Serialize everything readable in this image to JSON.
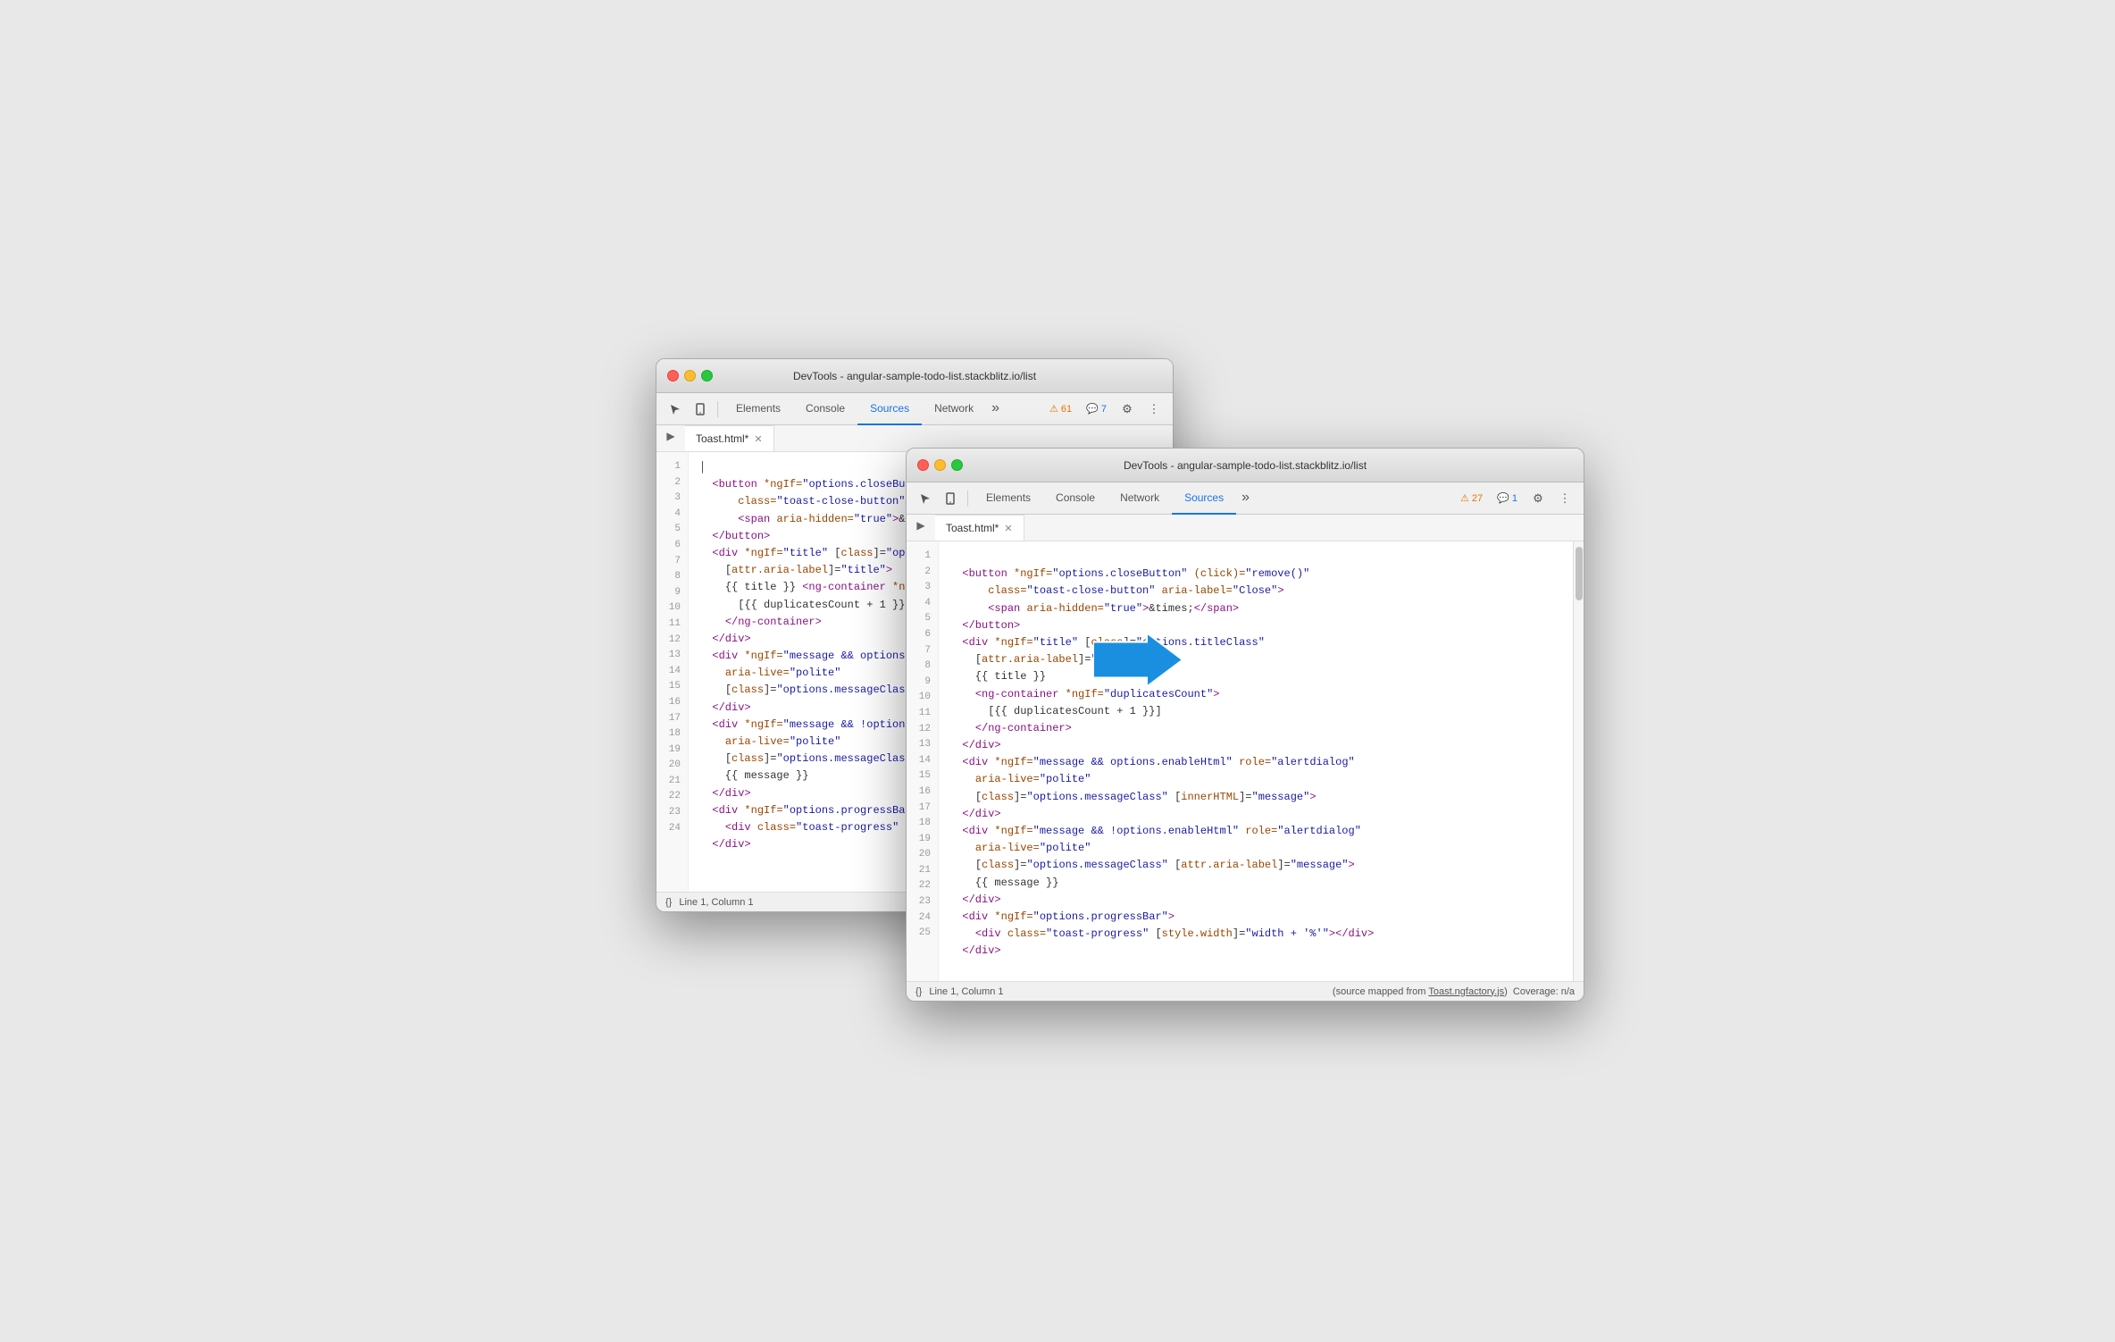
{
  "back_window": {
    "title": "DevTools - angular-sample-todo-list.stackblitz.io/list",
    "tabs": [
      "Elements",
      "Console",
      "Sources",
      "Network"
    ],
    "active_tab": "Sources",
    "file_tab": "Toast.html*",
    "badges": {
      "warning": "⚠ 61",
      "comment": "💬 7"
    },
    "statusbar": {
      "position": "Line 1, Column 1",
      "source": "(source mapped from "
    },
    "lines": [
      {
        "num": 1,
        "content": ""
      },
      {
        "num": 2,
        "code": "<button *ngIf=\"options.closeButton\" (cli"
      },
      {
        "num": 3,
        "code": "    class=\"toast-close-button\" aria-label="
      },
      {
        "num": 4,
        "code": "    <span aria-hidden=\"true\">&times;</span"
      },
      {
        "num": 5,
        "code": "</button>"
      },
      {
        "num": 6,
        "code": "<div *ngIf=\"title\" [class]=\"options.titl"
      },
      {
        "num": 7,
        "code": "  [attr.aria-label]=\"title\">"
      },
      {
        "num": 8,
        "code": "  {{ title }} <ng-container *ngIf=\"dupli"
      },
      {
        "num": 9,
        "code": "    [{{ duplicatesCount + 1 }}]"
      },
      {
        "num": 10,
        "code": "  </ng-container>"
      },
      {
        "num": 11,
        "code": "</div>"
      },
      {
        "num": 12,
        "code": "<div *ngIf=\"message && options.enabl"
      },
      {
        "num": 13,
        "code": "  aria-live=\"polite\""
      },
      {
        "num": 14,
        "code": "  [class]=\"options.messageClass\" [in"
      },
      {
        "num": 15,
        "code": "</div>"
      },
      {
        "num": 16,
        "code": "<div *ngIf=\"message && !options.enableHt"
      },
      {
        "num": 17,
        "code": "  aria-live=\"polite\""
      },
      {
        "num": 18,
        "code": "  [class]=\"options.messageClass\" [attr.a"
      },
      {
        "num": 19,
        "code": "  {{ message }}"
      },
      {
        "num": 20,
        "code": "</div>"
      },
      {
        "num": 21,
        "code": "<div *ngIf=\"options.progressBar\">"
      },
      {
        "num": 22,
        "code": "  <div class=\"toast-progress\" [style.wid"
      },
      {
        "num": 23,
        "code": "</div>"
      },
      {
        "num": 24,
        "code": ""
      }
    ]
  },
  "front_window": {
    "title": "DevTools - angular-sample-todo-list.stackblitz.io/list",
    "tabs": [
      "Elements",
      "Console",
      "Network",
      "Sources"
    ],
    "active_tab": "Sources",
    "file_tab": "Toast.html*",
    "badges": {
      "warning": "⚠ 27",
      "comment": "💬 1"
    },
    "statusbar": {
      "position": "Line 1, Column 1",
      "source": "(source mapped from ",
      "link": "Toast.ngfactory.js",
      "coverage": "Coverage: n/a"
    },
    "lines": [
      {
        "num": 1,
        "content": ""
      },
      {
        "num": 2,
        "html": "<span class='tag'>&lt;button</span> <span class='attr'>*ngIf=</span><span class='str-val'>\"options.closeButton\"</span> <span class='attr'>(click)=</span><span class='str-val'>\"remove()\"</span>"
      },
      {
        "num": 3,
        "html": "    <span class='attr'>class=</span><span class='str-val'>\"toast-close-button\"</span> <span class='attr'>aria-label=</span><span class='str-val'>\"Close\"</span><span class='tag'>&gt;</span>"
      },
      {
        "num": 4,
        "html": "    <span class='tag'>&lt;span</span> <span class='attr'>aria-hidden=</span><span class='str-val'>\"true\"</span><span class='tag'>&gt;</span><span class='text-content'>&amp;times;</span><span class='tag'>&lt;/span&gt;</span>"
      },
      {
        "num": 5,
        "html": "<span class='tag'>&lt;/button&gt;</span>"
      },
      {
        "num": 6,
        "html": "<span class='tag'>&lt;div</span> <span class='attr'>*ngIf=</span><span class='str-val'>\"title\"</span> <span class='bracket'>[</span><span class='attr'>class</span><span class='bracket'>]</span>=<span class='str-val'>\"options.titleClass\"</span>"
      },
      {
        "num": 7,
        "html": "  <span class='bracket'>[</span><span class='attr'>attr.aria-label</span><span class='bracket'>]</span>=<span class='str-val'>\"title\"</span><span class='tag'>&gt;</span>"
      },
      {
        "num": 8,
        "html": "  <span class='text-content'>{{ title }}</span>"
      },
      {
        "num": 9,
        "html": "  <span class='tag'>&lt;ng-container</span> <span class='attr'>*ngIf=</span><span class='str-val'>\"duplicatesCount\"</span><span class='tag'>&gt;</span>"
      },
      {
        "num": 10,
        "html": "    <span class='text-content'>[{{ duplicatesCount + 1 }}]</span>"
      },
      {
        "num": 11,
        "html": "  <span class='tag'>&lt;/ng-container&gt;</span>"
      },
      {
        "num": 12,
        "html": "<span class='tag'>&lt;/div&gt;</span>"
      },
      {
        "num": 13,
        "html": "<span class='tag'>&lt;div</span> <span class='attr'>*ngIf=</span><span class='str-val'>\"message &amp;&amp; options.enableHtml\"</span> <span class='attr'>role=</span><span class='str-val'>\"alertdialog\"</span>"
      },
      {
        "num": 14,
        "html": "  <span class='attr'>aria-live=</span><span class='str-val'>\"polite\"</span>"
      },
      {
        "num": 15,
        "html": "  <span class='bracket'>[</span><span class='attr'>class</span><span class='bracket'>]</span>=<span class='str-val'>\"options.messageClass\"</span> <span class='bracket'>[</span><span class='attr'>innerHTML</span><span class='bracket'>]</span>=<span class='str-val'>\"message\"</span><span class='tag'>&gt;</span>"
      },
      {
        "num": 16,
        "html": "<span class='tag'>&lt;/div&gt;</span>"
      },
      {
        "num": 17,
        "html": "<span class='tag'>&lt;div</span> <span class='attr'>*ngIf=</span><span class='str-val'>\"message &amp;&amp; !options.enableHtml\"</span> <span class='attr'>role=</span><span class='str-val'>\"alertdialog\"</span>"
      },
      {
        "num": 18,
        "html": "  <span class='attr'>aria-live=</span><span class='str-val'>\"polite\"</span>"
      },
      {
        "num": 19,
        "html": "  <span class='bracket'>[</span><span class='attr'>class</span><span class='bracket'>]</span>=<span class='str-val'>\"options.messageClass\"</span> <span class='bracket'>[</span><span class='attr'>attr.aria-label</span><span class='bracket'>]</span>=<span class='str-val'>\"message\"</span><span class='tag'>&gt;</span>"
      },
      {
        "num": 20,
        "html": "  <span class='text-content'>{{ message }}</span>"
      },
      {
        "num": 21,
        "html": "<span class='tag'>&lt;/div&gt;</span>"
      },
      {
        "num": 22,
        "html": "<span class='tag'>&lt;div</span> <span class='attr'>*ngIf=</span><span class='str-val'>\"options.progressBar\"</span><span class='tag'>&gt;</span>"
      },
      {
        "num": 23,
        "html": "  <span class='tag'>&lt;div</span> <span class='attr'>class=</span><span class='str-val'>\"toast-progress\"</span> <span class='bracket'>[</span><span class='attr'>style.width</span><span class='bracket'>]</span>=<span class='str-val'>\"width + '%'\"</span><span class='tag'>&gt;&lt;/div&gt;</span>"
      },
      {
        "num": 24,
        "html": "<span class='tag'>&lt;/div&gt;</span>"
      },
      {
        "num": 25,
        "html": ""
      }
    ]
  }
}
